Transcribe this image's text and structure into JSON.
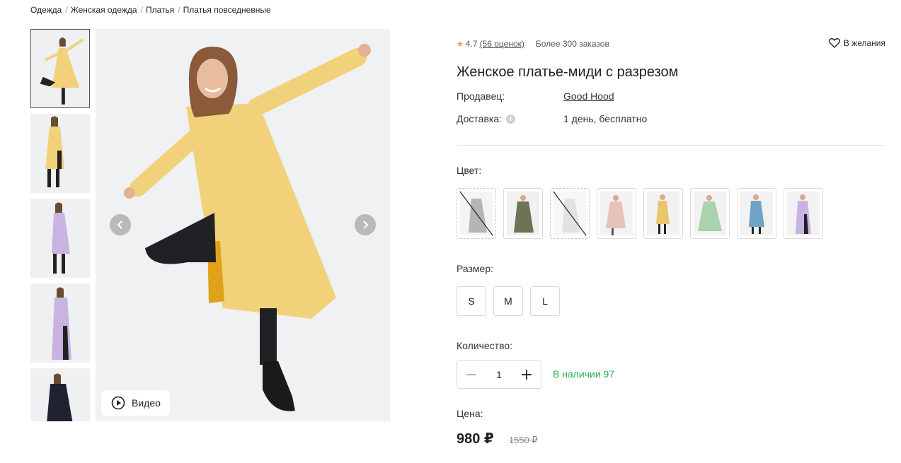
{
  "breadcrumb": [
    {
      "label": "Одежда"
    },
    {
      "label": "Женская одежда"
    },
    {
      "label": "Платья"
    },
    {
      "label": "Платья повседневные"
    }
  ],
  "gallery": {
    "video_label": "Видео",
    "thumbnail_colors": [
      "yellow",
      "yellow",
      "lavender",
      "lavender",
      "black"
    ]
  },
  "product": {
    "rating": "4.7",
    "reviews": "(56 оценок)",
    "orders": "Более 300 заказов",
    "wishlist_label": "В желания",
    "title": "Женское платье-миди с разрезом",
    "seller_label": "Продавец:",
    "seller_name": "Good Hood",
    "delivery_label": "Доставка:",
    "delivery_value": "1 день, бесплатно",
    "info_icon": "i",
    "color_label": "Цвет:",
    "colors": [
      {
        "name": "gray",
        "hex": "#8a8a8a",
        "available": false
      },
      {
        "name": "olive",
        "hex": "#6f7356",
        "available": true
      },
      {
        "name": "white",
        "hex": "#e8e8e8",
        "available": false
      },
      {
        "name": "pink",
        "hex": "#e7c2b8",
        "available": true
      },
      {
        "name": "yellow",
        "hex": "#e9c66b",
        "available": true
      },
      {
        "name": "mint",
        "hex": "#a9d2ae",
        "available": true
      },
      {
        "name": "blue",
        "hex": "#6fa3c7",
        "available": true
      },
      {
        "name": "lavender",
        "hex": "#c8b4e2",
        "available": true
      }
    ],
    "size_label": "Размер:",
    "sizes": [
      "S",
      "M",
      "L"
    ],
    "quantity_label": "Количество:",
    "quantity": "1",
    "stock": "В наличии 97",
    "price_label": "Цена:",
    "price": "980 ₽",
    "old_price": "1550 ₽"
  },
  "colors": {
    "accent_star": "#f0a030",
    "stock_green": "#2db24a",
    "dress_yellow": "#f1d27a"
  }
}
